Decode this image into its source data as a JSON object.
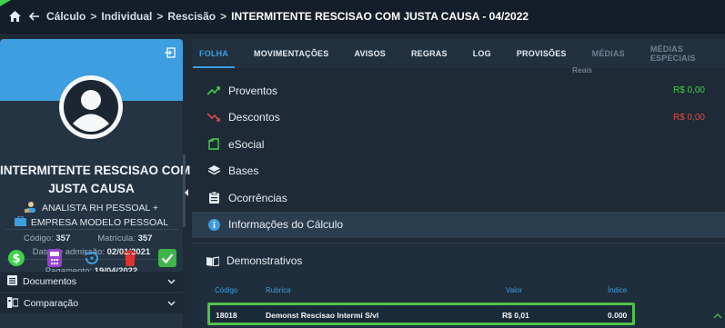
{
  "breadcrumb": {
    "items": [
      "Cálculo",
      "Individual",
      "Rescisão"
    ],
    "current": "INTERMITENTE RESCISAO COM JUSTA CAUSA - 04/2022"
  },
  "profile": {
    "name_line1": "INTERMITENTE RESCISAO COM",
    "name_line2": "JUSTA CAUSA",
    "role": "ANALISTA RH PESSOAL +",
    "company": "EMPRESA MODELO PESSOAL",
    "codigo_label": "Código:",
    "codigo_value": "357",
    "matricula_label": "Matrícula:",
    "matricula_value": "357",
    "admissao_label": "Data de admissão:",
    "admissao_value": "02/01/2021",
    "pagamento_label": "Pagamento:",
    "pagamento_value": "19/04/2022"
  },
  "accordions": [
    {
      "label": "Documentos",
      "icon": "document-list-icon"
    },
    {
      "label": "Comparação",
      "icon": "compare-icon"
    }
  ],
  "tabs": [
    {
      "label": "FOLHA",
      "state": "active"
    },
    {
      "label": "MOVIMENTAÇÕES",
      "state": "normal"
    },
    {
      "label": "AVISOS",
      "state": "normal"
    },
    {
      "label": "REGRAS",
      "state": "normal"
    },
    {
      "label": "LOG",
      "state": "normal"
    },
    {
      "label": "PROVISÕES",
      "state": "normal"
    },
    {
      "label": "MÉDIAS",
      "state": "disabled"
    },
    {
      "label": "MÉDIAS ESPECIAIS",
      "state": "disabled"
    }
  ],
  "partial_label": "Reais",
  "menu": [
    {
      "label": "Proventos",
      "value": "R$ 0,00",
      "value_color": "#3fd24a",
      "icon_color": "#3fd24a"
    },
    {
      "label": "Descontos",
      "value": "R$ 0,00",
      "value_color": "#e04b4b",
      "icon_color": "#e04b4b"
    },
    {
      "label": "eSocial",
      "value": "",
      "icon_color": "#3fd24a"
    },
    {
      "label": "Bases",
      "value": "",
      "icon_color": "#e8edf2"
    },
    {
      "label": "Ocorrências",
      "value": "",
      "icon_color": "#e8edf2"
    },
    {
      "label": "Informações do Cálculo",
      "value": "",
      "icon_color": "#3d9ee0"
    }
  ],
  "demonstrativos": {
    "title": "Demonstrativos",
    "headers": {
      "codigo": "Código",
      "rubrica": "Rubrica",
      "valor": "Valor",
      "indice": "Índice"
    },
    "rows": [
      {
        "codigo": "18018",
        "rubrica": "Demonst Rescisao Intermi S/vl",
        "valor": "R$ 0,01",
        "indice": "0.000"
      }
    ]
  },
  "colors": {
    "accent": "#3d9ee0",
    "positive": "#3fd24a",
    "negative": "#e04b4b",
    "highlight_border": "#4fc24a"
  }
}
